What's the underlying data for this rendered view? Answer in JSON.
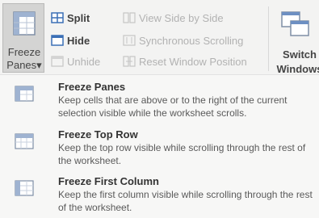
{
  "ribbon": {
    "freeze_panes": {
      "label_line1": "Freeze",
      "label_line2": "Panes",
      "dropdown_arrow": "▾",
      "icon": "freeze-panes-icon"
    },
    "split": {
      "label": "Split",
      "icon": "split-icon"
    },
    "hide": {
      "label": "Hide",
      "icon": "hide-icon"
    },
    "unhide": {
      "label": "Unhide",
      "icon": "unhide-icon"
    },
    "view_side_by_side": {
      "label": "View Side by Side",
      "icon": "view-side-by-side-icon"
    },
    "synchronous_scrolling": {
      "label": "Synchronous Scrolling",
      "icon": "synchronous-scrolling-icon"
    },
    "reset_window_position": {
      "label": "Reset Window Position",
      "icon": "reset-window-position-icon"
    },
    "switch_windows": {
      "label_line1": "Switch",
      "label_line2": "Windows",
      "icon": "switch-windows-icon"
    }
  },
  "menu": {
    "items": [
      {
        "title": "Freeze Panes",
        "description": "Keep cells that are above or to the right of the current selection visible while the worksheet scrolls.",
        "icon": "freeze-panes-icon"
      },
      {
        "title": "Freeze Top Row",
        "description": "Keep the top row visible while scrolling through the rest of the worksheet.",
        "icon": "freeze-top-row-icon"
      },
      {
        "title": "Freeze First Column",
        "description": "Keep the first column visible while scrolling through the rest of the worksheet.",
        "icon": "freeze-first-column-icon"
      }
    ]
  }
}
